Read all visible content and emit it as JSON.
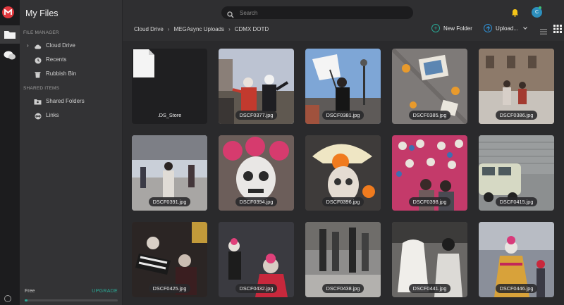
{
  "sidebar": {
    "title": "My Files",
    "file_manager_label": "FILE MANAGER",
    "shared_items_label": "SHARED ITEMS",
    "items": [
      {
        "label": "Cloud Drive",
        "icon": "cloud-icon"
      },
      {
        "label": "Recents",
        "icon": "clock-icon"
      },
      {
        "label": "Rubbish Bin",
        "icon": "trash-icon"
      },
      {
        "label": "Shared Folders",
        "icon": "shared-folder-icon"
      },
      {
        "label": "Links",
        "icon": "link-icon"
      }
    ],
    "free_label": "Free",
    "upgrade_label": "UPGRADE",
    "storage_used_fraction": 0.03
  },
  "search": {
    "placeholder": "Search",
    "value": ""
  },
  "avatar": {
    "initial": "C"
  },
  "breadcrumb": [
    "Cloud Drive",
    "MEGAsync Uploads",
    "CDMX DOTD"
  ],
  "toolbar": {
    "new_folder": "New Folder",
    "upload": "Upload..."
  },
  "colors": {
    "accent": "#2aa996",
    "brand_red": "#e0383e",
    "upload_blue": "#2f8fd3"
  },
  "files": [
    {
      "name": ".DS_Store",
      "type": "document"
    },
    {
      "name": "DSCF0377.jpg",
      "type": "image"
    },
    {
      "name": "DSCF0381.jpg",
      "type": "image"
    },
    {
      "name": "DSCF0385.jpg",
      "type": "image"
    },
    {
      "name": "DSCF0386.jpg",
      "type": "image"
    },
    {
      "name": "DSCF0391.jpg",
      "type": "image"
    },
    {
      "name": "DSCF0394.jpg",
      "type": "image"
    },
    {
      "name": "DSCF0396.jpg",
      "type": "image"
    },
    {
      "name": "DSCF0398.jpg",
      "type": "image"
    },
    {
      "name": "DSCF0415.jpg",
      "type": "image"
    },
    {
      "name": "DSCF0425.jpg",
      "type": "image"
    },
    {
      "name": "DSCF0432.jpg",
      "type": "image"
    },
    {
      "name": "DSCF0438.jpg",
      "type": "image"
    },
    {
      "name": "DSCF0441.jpg",
      "type": "image"
    },
    {
      "name": "DSCF0446.jpg",
      "type": "image"
    }
  ]
}
